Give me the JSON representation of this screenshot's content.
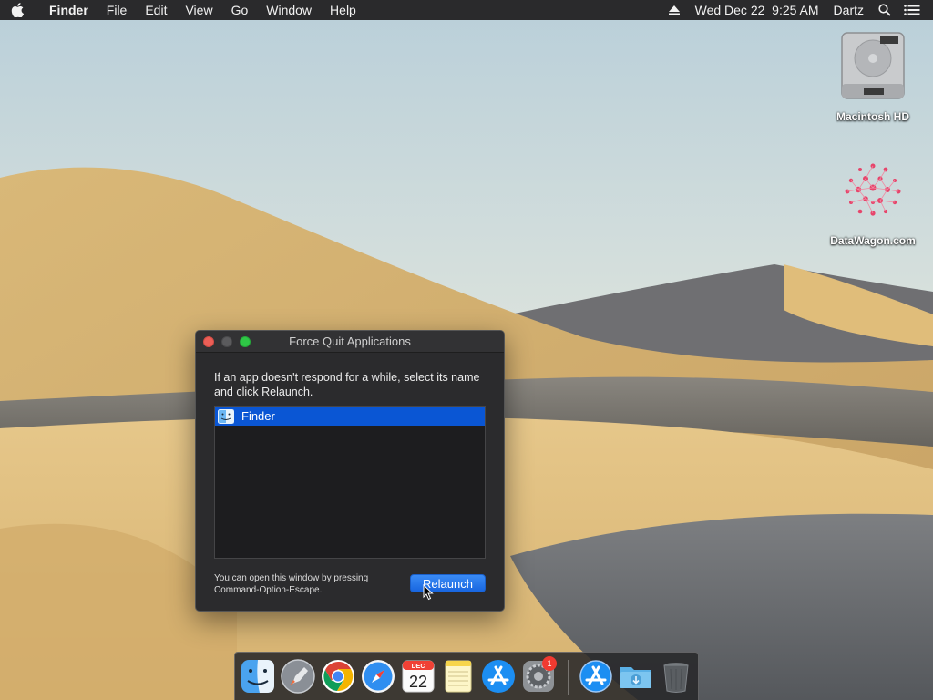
{
  "menubar": {
    "apple_icon": "apple-logo-icon",
    "app_name": "Finder",
    "menus": [
      "File",
      "Edit",
      "View",
      "Go",
      "Window",
      "Help"
    ],
    "datetime": "Wed Dec 22  9:25 AM",
    "user": "Dartz",
    "icons": [
      "eject-icon",
      "spotlight-search-icon",
      "notification-center-icon"
    ]
  },
  "desktop": {
    "icons": [
      {
        "label": "Macintosh HD",
        "icon": "hard-drive-icon"
      },
      {
        "label": "DataWagon.com",
        "icon": "network-logo-icon"
      }
    ]
  },
  "force_quit": {
    "title": "Force Quit Applications",
    "description": "If an app doesn't respond for a while, select its name and click Relaunch.",
    "apps": [
      {
        "name": "Finder",
        "selected": true,
        "icon": "finder-icon"
      }
    ],
    "hint": "You can open this window by pressing Command-Option-Escape.",
    "button_label": "Relaunch"
  },
  "dock": {
    "calendar_month": "DEC",
    "calendar_day": "22",
    "system_prefs_badge": "1",
    "items": [
      {
        "icon": "finder-icon",
        "running": true
      },
      {
        "icon": "launchpad-icon",
        "running": false
      },
      {
        "icon": "chrome-icon",
        "running": false
      },
      {
        "icon": "safari-icon",
        "running": false
      },
      {
        "icon": "calendar-icon",
        "running": false
      },
      {
        "icon": "notes-icon",
        "running": false
      },
      {
        "icon": "app-store-icon",
        "running": false
      },
      {
        "icon": "system-preferences-icon",
        "running": false
      },
      {
        "icon": "app-store-download-icon",
        "running": false
      },
      {
        "icon": "downloads-folder-icon",
        "running": false
      },
      {
        "icon": "trash-icon",
        "running": false
      }
    ]
  },
  "colors": {
    "selection": "#0a56d4",
    "button": "#1a6ae6",
    "close": "#ec5f57",
    "zoom": "#2fc746"
  }
}
